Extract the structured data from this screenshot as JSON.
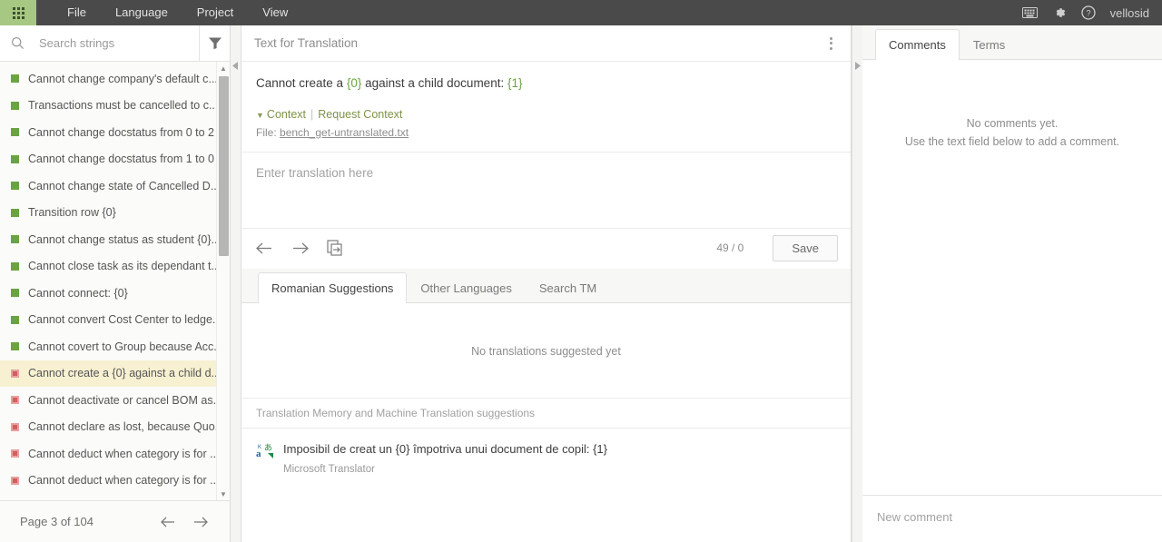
{
  "topbar": {
    "logo_icon": "app-grid-icon",
    "menu": [
      {
        "label": "File"
      },
      {
        "label": "Language"
      },
      {
        "label": "Project"
      },
      {
        "label": "View"
      }
    ],
    "icons": [
      {
        "name": "keyboard-icon"
      },
      {
        "name": "gear-icon"
      },
      {
        "name": "help-icon"
      }
    ],
    "username": "vellosid"
  },
  "sidebar": {
    "search": {
      "placeholder": "Search strings",
      "value": "",
      "icon": "search-icon"
    },
    "filter_icon": "filter-funnel-icon",
    "strings": [
      {
        "label": "Cannot change company's default c...",
        "status": "translated",
        "selected": false
      },
      {
        "label": "Transactions must be cancelled to c...",
        "status": "translated",
        "selected": false
      },
      {
        "label": "Cannot change docstatus from 0 to 2",
        "status": "translated",
        "selected": false
      },
      {
        "label": "Cannot change docstatus from 1 to 0",
        "status": "translated",
        "selected": false
      },
      {
        "label": "Cannot change state of Cancelled D...",
        "status": "translated",
        "selected": false
      },
      {
        "label": "Transition row {0}",
        "status": "translated",
        "selected": false
      },
      {
        "label": "Cannot change status as student {0}...",
        "status": "translated",
        "selected": false
      },
      {
        "label": "Cannot close task as its dependant t...",
        "status": "translated",
        "selected": false
      },
      {
        "label": "Cannot connect: {0}",
        "status": "translated",
        "selected": false
      },
      {
        "label": "Cannot convert Cost Center to ledge...",
        "status": "translated",
        "selected": false
      },
      {
        "label": "Cannot covert to Group because Acc...",
        "status": "translated",
        "selected": false
      },
      {
        "label": "Cannot create a {0} against a child d...",
        "status": "untranslated",
        "selected": true
      },
      {
        "label": "Cannot deactivate or cancel BOM as...",
        "status": "untranslated",
        "selected": false
      },
      {
        "label": "Cannot declare as lost, because Quo...",
        "status": "untranslated",
        "selected": false
      },
      {
        "label": "Cannot deduct when category is for ...",
        "status": "untranslated",
        "selected": false
      },
      {
        "label": "Cannot deduct when category is for ...",
        "status": "untranslated",
        "selected": false
      }
    ],
    "pager": {
      "label": "Page 3 of 104",
      "prev_icon": "arrow-left-icon",
      "next_icon": "arrow-right-icon"
    }
  },
  "center": {
    "collapse_left_icon": "collapse-left-icon",
    "collapse_right_icon": "collapse-right-icon",
    "title": "Text for Translation",
    "kebab_icon": "more-options-icon",
    "source": {
      "parts": [
        {
          "text": "Cannot create a ",
          "placeholder": false
        },
        {
          "text": "{0}",
          "placeholder": true
        },
        {
          "text": " against a child document: ",
          "placeholder": false
        },
        {
          "text": "{1}",
          "placeholder": true
        }
      ]
    },
    "context": {
      "caret_icon": "caret-down-icon",
      "label": "Context",
      "request_label": "Request Context",
      "file_prefix": "File:",
      "file_name": "bench_get-untranslated.txt"
    },
    "editor": {
      "placeholder": "Enter translation here",
      "value": "",
      "prev_icon": "arrow-left-icon",
      "next_icon": "arrow-right-icon",
      "copy_icon": "copy-source-icon",
      "char_count": "49 / 0",
      "save_label": "Save"
    },
    "suggestion_tabs": [
      {
        "label": "Romanian Suggestions",
        "active": true
      },
      {
        "label": "Other Languages",
        "active": false
      },
      {
        "label": "Search TM",
        "active": false
      }
    ],
    "suggestions_empty": "No translations suggested yet",
    "tm_section_label": "Translation Memory and Machine Translation suggestions",
    "machine_suggestions": [
      {
        "icon": "translator-icon",
        "text": "Imposibil de creat un {0} împotriva unui document de copil: {1}",
        "source": "Microsoft Translator"
      }
    ]
  },
  "right_panel": {
    "tabs": [
      {
        "label": "Comments",
        "active": true
      },
      {
        "label": "Terms",
        "active": false
      }
    ],
    "empty_line1": "No comments yet.",
    "empty_line2": "Use the text field below to add a comment.",
    "new_comment_placeholder": "New comment",
    "new_comment_value": ""
  },
  "colors": {
    "topbar_bg": "#4a4a4a",
    "logo_bg": "#a6c882",
    "accent_green": "#6aa341",
    "selected_row": "#f7f1d2",
    "untranslated": "#d35e5e"
  }
}
